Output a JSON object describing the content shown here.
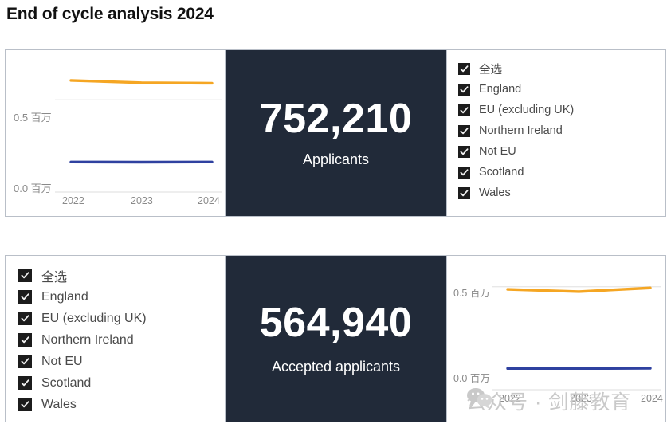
{
  "page": {
    "title": "End of cycle analysis 2024"
  },
  "colors": {
    "kpi_background": "#212a39",
    "kpi_text": "#ffffff",
    "series_orange": "#f5a623",
    "series_blue": "#2f41a0",
    "card_border": "#b9bfc8",
    "axis_text": "#8a8a8a",
    "checkbox_fill": "#1c1c1c",
    "checkmark": "#f2f2f2",
    "watermark": "#c9c9c9"
  },
  "cards": [
    {
      "id": "applicants",
      "kpi": {
        "value": "752,210",
        "label": "Applicants"
      },
      "legend": {
        "items": [
          {
            "label": "全选",
            "checked": true
          },
          {
            "label": "England",
            "checked": true
          },
          {
            "label": "EU (excluding UK)",
            "checked": true
          },
          {
            "label": "Northern Ireland",
            "checked": true
          },
          {
            "label": "Not EU",
            "checked": true
          },
          {
            "label": "Scotland",
            "checked": true
          },
          {
            "label": "Wales",
            "checked": true
          }
        ]
      }
    },
    {
      "id": "accepted-applicants",
      "kpi": {
        "value": "564,940",
        "label": "Accepted applicants"
      },
      "legend": {
        "items": [
          {
            "label": "全选",
            "checked": true
          },
          {
            "label": "England",
            "checked": true
          },
          {
            "label": "EU (excluding UK)",
            "checked": true
          },
          {
            "label": "Northern Ireland",
            "checked": true
          },
          {
            "label": "Not EU",
            "checked": true
          },
          {
            "label": "Scotland",
            "checked": true
          },
          {
            "label": "Wales",
            "checked": true
          }
        ]
      }
    }
  ],
  "watermark": {
    "text": "公众号 · 剑藤教育",
    "icon": "wechat-icon"
  },
  "chart_data": [
    {
      "type": "line",
      "id": "applicants-trend",
      "title": "",
      "xlabel": "",
      "ylabel": "",
      "x": [
        "2022",
        "2023",
        "2024"
      ],
      "tick_labels_y": [
        "0.0 百万",
        "0.5 百万"
      ],
      "ylim": [
        0.0,
        0.7
      ],
      "yticks": [
        0.0,
        0.5
      ],
      "grid": true,
      "legend_position": "none",
      "series": [
        {
          "name": "England",
          "color": "#f5a623",
          "values": [
            0.605,
            0.593,
            0.59
          ]
        },
        {
          "name": "Not EU",
          "color": "#2f41a0",
          "values": [
            0.163,
            0.162,
            0.163
          ]
        }
      ]
    },
    {
      "type": "line",
      "id": "accepted-applicants-trend",
      "title": "",
      "xlabel": "",
      "ylabel": "",
      "x": [
        "2022",
        "2023",
        "2024"
      ],
      "tick_labels_y": [
        "0.0 百万",
        "0.5 百万"
      ],
      "ylim": [
        0.0,
        0.58
      ],
      "yticks": [
        0.0,
        0.5
      ],
      "grid": true,
      "legend_position": "none",
      "series": [
        {
          "name": "England",
          "color": "#f5a623",
          "values": [
            0.487,
            0.476,
            0.494
          ]
        },
        {
          "name": "Not EU",
          "color": "#2f41a0",
          "values": [
            0.103,
            0.103,
            0.104
          ]
        }
      ]
    }
  ]
}
